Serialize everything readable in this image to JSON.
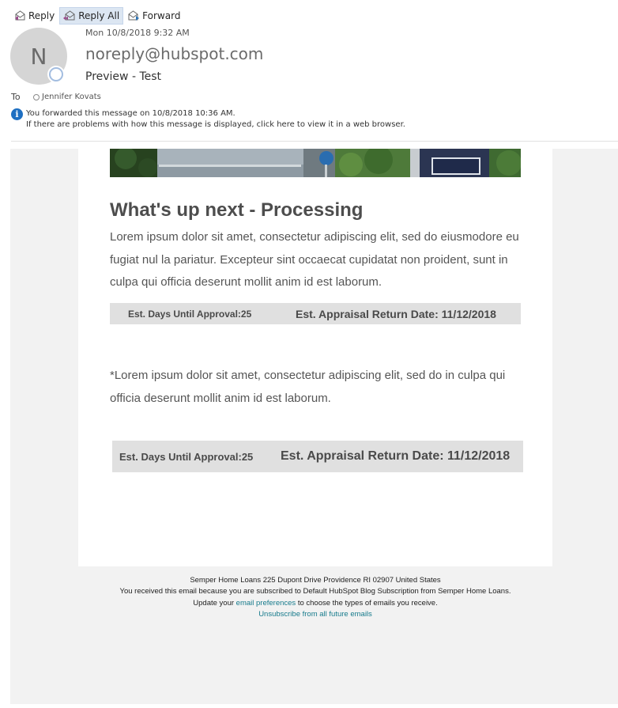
{
  "toolbar": {
    "reply": "Reply",
    "reply_all": "Reply All",
    "forward": "Forward"
  },
  "message": {
    "avatar_initial": "N",
    "date": "Mon 10/8/2018 9:32 AM",
    "sender": "noreply@hubspot.com",
    "subject": "Preview - Test",
    "to_label": "To",
    "recipient": "Jennifer Kovats",
    "info_line1": "You forwarded this message on 10/8/2018 10:36 AM.",
    "info_line2": "If there are problems with how this message is displayed, click here to view it in a web browser."
  },
  "email": {
    "heading": "What's up next - Processing",
    "paragraph": "Lorem ipsum dolor sit amet, consectetur adipiscing elit, sed do eiusmodore eu fugiat nul la pariatur. Excepteur sint occaecat cupidatat non proident, sunt in culpa qui officia deserunt mollit anim id est laborum.",
    "est_bar_1": {
      "days": "Est. Days Until Approval:25",
      "appraisal": "Est. Appraisal Return Date: 11/12/2018"
    },
    "note": "*Lorem ipsum dolor sit amet, consectetur adipiscing elit, sed do in culpa qui officia deserunt mollit anim id est laborum.",
    "est_bar_2": {
      "days": "Est. Days Until Approval:25",
      "appraisal": "Est. Appraisal Return Date: 11/12/2018"
    }
  },
  "footer": {
    "address": "Semper Home Loans  225 Dupont Drive    Providence  RI  02907  United States",
    "subscribed": "You received this email because you are subscribed to Default HubSpot Blog Subscription from Semper Home Loans.",
    "update_prefix": "Update your ",
    "preferences_link": "email preferences",
    "update_suffix": " to choose the types of emails you receive.",
    "unsubscribe_link": "Unsubscribe from all future emails"
  },
  "colors": {
    "link": "#177b8c",
    "info_icon": "#1e6fc2",
    "est_bar_bg": "#e0e0e0",
    "email_bg": "#f2f2f2"
  },
  "icons": [
    "reply-icon",
    "reply-all-icon",
    "forward-icon",
    "info-icon",
    "presence-icon",
    "recipient-status-icon"
  ]
}
